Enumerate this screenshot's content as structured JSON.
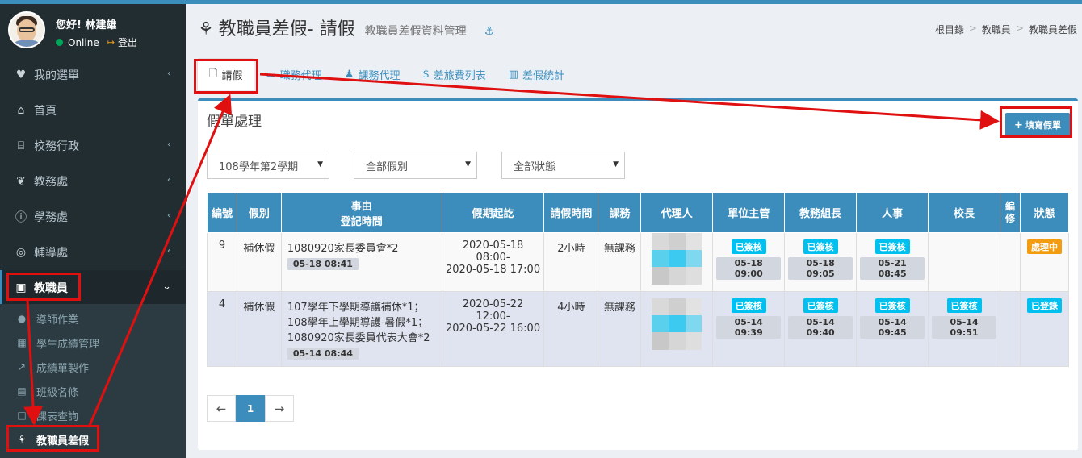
{
  "user": {
    "greeting": "您好! 林建雄",
    "status": "Online",
    "logout": "登出"
  },
  "sidebar": {
    "items": [
      {
        "label": "我的選單",
        "icon": "heart-icon"
      },
      {
        "label": "首頁",
        "icon": "home-icon"
      },
      {
        "label": "校務行政",
        "icon": "bank-icon"
      },
      {
        "label": "教務處",
        "icon": "leaf-icon"
      },
      {
        "label": "學務處",
        "icon": "info-icon"
      },
      {
        "label": "輔導處",
        "icon": "lifebuoy-icon"
      },
      {
        "label": "教職員",
        "icon": "contact-card-icon"
      }
    ],
    "submenu": [
      {
        "label": "導師作業",
        "icon": "user-icon"
      },
      {
        "label": "學生成績管理",
        "icon": "table-icon"
      },
      {
        "label": "成績單製作",
        "icon": "line-chart-icon"
      },
      {
        "label": "班級名條",
        "icon": "id-card-icon"
      },
      {
        "label": "課表查詢",
        "icon": "square-icon"
      },
      {
        "label": "教職員差假",
        "icon": "tree-icon"
      }
    ]
  },
  "header": {
    "title": "教職員差假- 請假",
    "subtitle": "教職員差假資料管理",
    "breadcrumb": [
      "根目錄",
      "教職員",
      "教職員差假"
    ]
  },
  "tabs": [
    {
      "label": "請假",
      "icon": "file-icon"
    },
    {
      "label": "職務代理",
      "icon": "monitor-icon"
    },
    {
      "label": "課務代理",
      "icon": "person-icon"
    },
    {
      "label": "差旅費列表",
      "icon": "dollar-icon"
    },
    {
      "label": "差假統計",
      "icon": "bar-chart-icon"
    }
  ],
  "box": {
    "title": "假單處理",
    "add_button": "填寫假單"
  },
  "filters": {
    "semester": "108學年第2學期",
    "leave_type": "全部假別",
    "status": "全部狀態"
  },
  "table": {
    "headers": [
      "編號",
      "假別",
      "事由",
      "登記時間",
      "假期起訖",
      "請假時間",
      "課務",
      "代理人",
      "單位主管",
      "教務組長",
      "人事",
      "校長",
      "編修",
      "狀態"
    ],
    "rows": [
      {
        "id": "9",
        "type": "補休假",
        "reason": [
          "1080920家長委員會*2"
        ],
        "reg_time": "05-18 08:41",
        "period": [
          "2020-05-18 08:00-",
          "2020-05-18 17:00"
        ],
        "duration": "2小時",
        "course": "無課務",
        "supervisor": {
          "tag": "已簽核",
          "time": "05-18 09:00"
        },
        "academic": {
          "tag": "已簽核",
          "time": "05-18 09:05"
        },
        "personnel": {
          "tag": "已簽核",
          "time": "05-21 08:45"
        },
        "principal": {
          "tag": "",
          "time": ""
        },
        "state": "處理中"
      },
      {
        "id": "4",
        "type": "補休假",
        "reason": [
          "107學年下學期導護補休*1；",
          "108學年上學期導護-暑假*1；",
          "1080920家長委員代表大會*2"
        ],
        "reg_time": "05-14 08:44",
        "period": [
          "2020-05-22 12:00-",
          "2020-05-22 16:00"
        ],
        "duration": "4小時",
        "course": "無課務",
        "supervisor": {
          "tag": "已簽核",
          "time": "05-14 09:39"
        },
        "academic": {
          "tag": "已簽核",
          "time": "05-14 09:40"
        },
        "personnel": {
          "tag": "已簽核",
          "time": "05-14 09:45"
        },
        "principal": {
          "tag": "已簽核",
          "time": "05-14 09:51"
        },
        "state": "已登錄"
      }
    ]
  },
  "pager": {
    "prev": "←",
    "current": "1",
    "next": "→"
  },
  "colors": {
    "primary": "#3c8dbc",
    "sidebar": "#222d32",
    "annotation": "#e01010",
    "info": "#00c0ef",
    "warning": "#f39c12"
  }
}
